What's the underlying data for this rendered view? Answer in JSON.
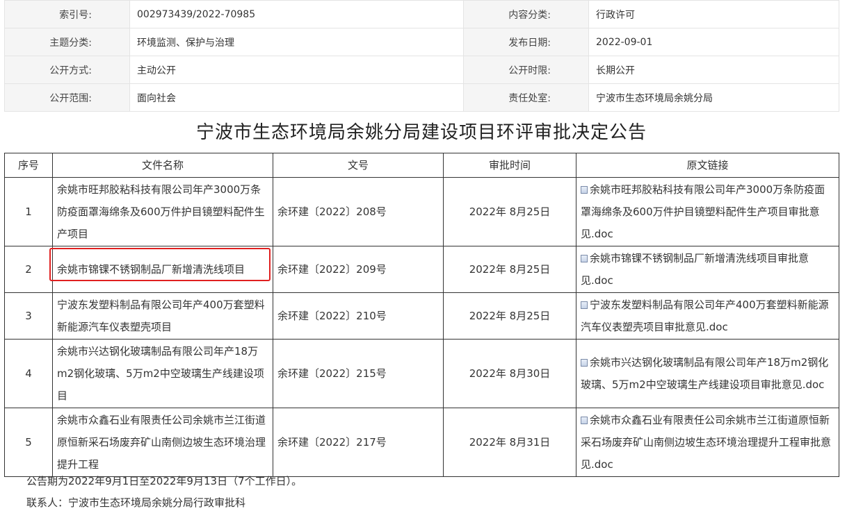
{
  "meta": [
    {
      "k1": "索引号:",
      "v1": "002973439/2022-70985",
      "k2": "内容分类:",
      "v2": "行政许可"
    },
    {
      "k1": "主题分类:",
      "v1": "环境监测、保护与治理",
      "k2": "发布日期:",
      "v2": "2022-09-01"
    },
    {
      "k1": "公开方式:",
      "v1": "主动公开",
      "k2": "公开时限:",
      "v2": "长期公开"
    },
    {
      "k1": "公开范围:",
      "v1": "面向社会",
      "k2": "责任处室:",
      "v2": "宁波市生态环境局余姚分局"
    }
  ],
  "title": "宁波市生态环境局余姚分局建设项目环评审批决定公告",
  "table": {
    "headers": [
      "序号",
      "文件名称",
      "文号",
      "审批时间",
      "原文链接"
    ],
    "rows": [
      {
        "no": "1",
        "name": "余姚市旺邦胶粘科技有限公司年产3000万条防疫面罩海绵条及600万件护目镜塑料配件生产项目",
        "doc_no": "余环建〔2022〕208号",
        "date": "2022年 8月25日",
        "link": "余姚市旺邦胶粘科技有限公司年产3000万条防疫面罩海绵条及600万件护目镜塑料配件生产项目审批意见.doc"
      },
      {
        "no": "2",
        "name": "余姚市锦锞不锈钢制品厂新增清洗线项目",
        "doc_no": "余环建〔2022〕209号",
        "date": "2022年 8月25日",
        "link": "余姚市锦锞不锈钢制品厂新增清洗线项目审批意见.doc"
      },
      {
        "no": "3",
        "name": "宁波东发塑料制品有限公司年产400万套塑料新能源汽车仪表塑壳项目",
        "doc_no": "余环建〔2022〕210号",
        "date": "2022年 8月25日",
        "link": "宁波东发塑料制品有限公司年产400万套塑料新能源汽车仪表塑壳项目审批意见.doc"
      },
      {
        "no": "4",
        "name": "余姚市兴达钢化玻璃制品有限公司年产18万m2钢化玻璃、5万m2中空玻璃生产线建设项目",
        "doc_no": "余环建〔2022〕215号",
        "date": "2022年 8月30日",
        "link": "余姚市兴达钢化玻璃制品有限公司年产18万m2钢化玻璃、5万m2中空玻璃生产线建设项目审批意见.doc"
      },
      {
        "no": "5",
        "name": "余姚市众鑫石业有限责任公司余姚市兰江街道原恒新采石场废弃矿山南侧边坡生态环境治理提升工程",
        "doc_no": "余环建〔2022〕217号",
        "date": "2022年 8月31日",
        "link": "余姚市众鑫石业有限责任公司余姚市兰江街道原恒新采石场废弃矿山南侧边坡生态环境治理提升工程审批意见.doc"
      }
    ]
  },
  "notice": "公告期为2022年9月1日至2022年9月13日（7个工作日）。",
  "contact": "联系人：宁波市生态环境局余姚分局行政审批科"
}
